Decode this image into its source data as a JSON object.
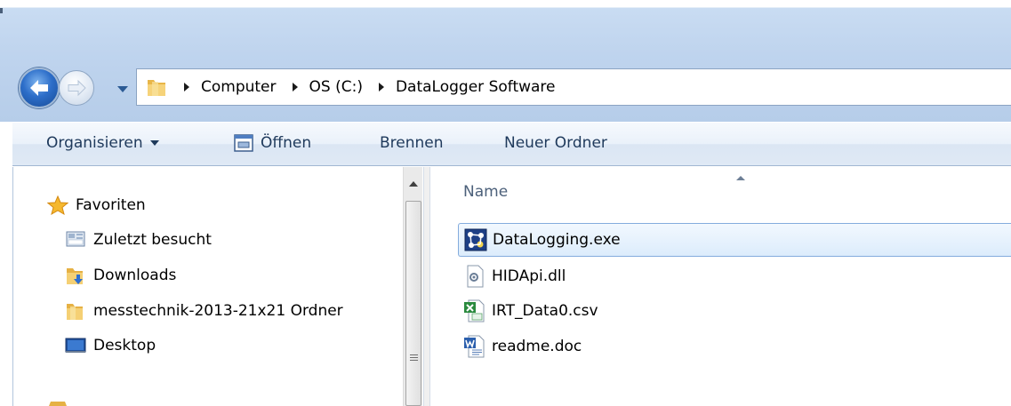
{
  "address_bar": {
    "breadcrumbs": [
      "Computer",
      "OS (C:)",
      "DataLogger Software"
    ]
  },
  "toolbar": {
    "organize_label": "Organisieren",
    "open_label": "Öffnen",
    "burn_label": "Brennen",
    "new_folder_label": "Neuer Ordner"
  },
  "navigation": {
    "favorites_label": "Favoriten",
    "items": [
      {
        "label": "Zuletzt besucht",
        "icon": "recent-places-icon"
      },
      {
        "label": "Downloads",
        "icon": "downloads-folder-icon"
      },
      {
        "label": "messtechnik-2013-21x21 Ordner",
        "icon": "folder-icon"
      },
      {
        "label": "Desktop",
        "icon": "desktop-icon"
      }
    ]
  },
  "file_list": {
    "column_header": "Name",
    "files": [
      {
        "name": "DataLogging.exe",
        "icon": "application-icon",
        "selected": true
      },
      {
        "name": "HIDApi.dll",
        "icon": "dll-file-icon",
        "selected": false
      },
      {
        "name": "IRT_Data0.csv",
        "icon": "excel-csv-icon",
        "selected": false
      },
      {
        "name": "readme.doc",
        "icon": "word-document-icon",
        "selected": false
      }
    ]
  },
  "colors": {
    "selection_border": "#84acdd",
    "command_text": "#1e395b",
    "frame_blue": "#bfd4ee"
  }
}
